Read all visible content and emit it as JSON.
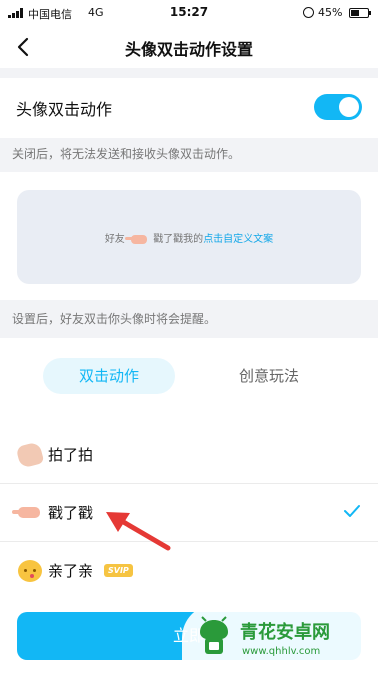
{
  "status_bar": {
    "carrier": "中国电信",
    "network": "4G",
    "time": "15:27",
    "battery": "45%"
  },
  "nav": {
    "title": "头像双击动作设置",
    "back_icon": "chevron-left-icon"
  },
  "toggle_row": {
    "label": "头像双击动作",
    "enabled": true
  },
  "hint_toggle": "关闭后，将无法发送和接收头像双击动作。",
  "preview": {
    "prefix": "好友",
    "middle": "戳了戳我的",
    "link": "点击自定义文案"
  },
  "hint_setting": "设置后，好友双击你头像时将会提醒。",
  "tabs": [
    {
      "label": "双击动作",
      "active": true
    },
    {
      "label": "创意玩法",
      "active": false
    }
  ],
  "actions": [
    {
      "label": "拍了拍",
      "icon": "waving-hand-icon",
      "selected": false
    },
    {
      "label": "戳了戳",
      "icon": "pointing-hand-icon",
      "selected": true
    },
    {
      "label": "亲了亲",
      "icon": "kissing-face-icon",
      "selected": false,
      "badge": "SVIP"
    }
  ],
  "apply_button": {
    "label": "立即"
  },
  "watermark": {
    "title": "青花安卓网",
    "url": "www.qhhlv.com"
  },
  "colors": {
    "accent": "#12b7f5",
    "annotation_arrow": "#e53935",
    "watermark_green": "#2a9a3a"
  }
}
